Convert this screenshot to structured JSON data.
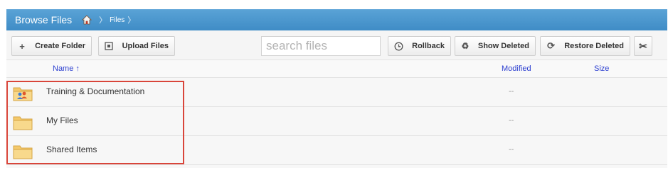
{
  "titlebar": {
    "title": "Browse Files",
    "breadcrumb": [
      "Files"
    ]
  },
  "toolbar": {
    "create_folder": "Create Folder",
    "upload_files": "Upload Files",
    "search_placeholder": "search files",
    "rollback": "Rollback",
    "show_deleted": "Show Deleted",
    "restore_deleted": "Restore Deleted"
  },
  "columns": {
    "name": "Name ↑",
    "modified": "Modified",
    "size": "Size"
  },
  "files": [
    {
      "name": "Training & Documentation",
      "modified": "--",
      "icon": "shared-folder-icon"
    },
    {
      "name": "My Files",
      "modified": "--",
      "icon": "folder-icon"
    },
    {
      "name": "Shared Items",
      "modified": "--",
      "icon": "folder-icon"
    }
  ],
  "colors": {
    "titlebar": "#4a97cf",
    "link": "#2c3fd0",
    "highlight": "#d9453a"
  }
}
